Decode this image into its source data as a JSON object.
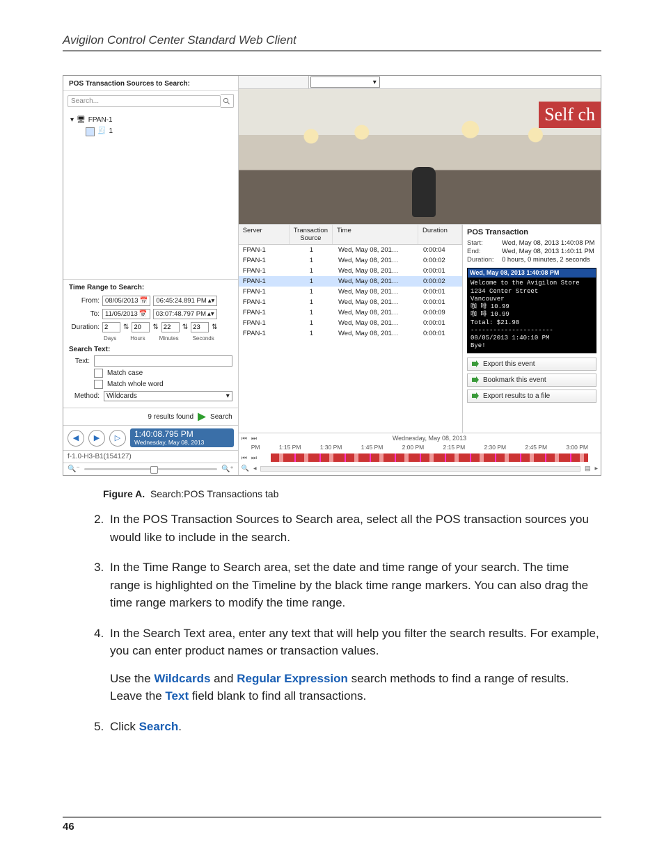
{
  "header": {
    "running": "Avigilon Control Center Standard Web Client"
  },
  "pageNumber": "46",
  "caption": {
    "label": "Figure A.",
    "text": "Search:POS Transactions tab"
  },
  "instructions": [
    {
      "n": "2.",
      "text": "In the POS Transaction Sources to Search area, select all the POS transaction sources you would like to include in the search."
    },
    {
      "n": "3.",
      "text": "In the Time Range to Search area, set the date and time range of your search. The time range is highlighted on the Timeline by the black time range markers. You can also drag the time range markers to modify the time range."
    },
    {
      "n": "4.",
      "text": "In the Search Text area, enter any text that will help you filter the search results. For example, you can enter product names or transaction values.",
      "extra_pre": "Use the ",
      "kw1": "Wildcards",
      "mid1": " and ",
      "kw2": "Regular Expression",
      "mid2": " search methods to find a range of results. Leave the ",
      "kw3": "Text",
      "post": " field blank to find all transactions."
    },
    {
      "n": "5.",
      "pre": "Click ",
      "kw": "Search",
      "post": "."
    }
  ],
  "left": {
    "title": "POS Transaction Sources to Search:",
    "searchPlaceholder": "Search...",
    "tree": {
      "root": "FPAN-1",
      "child": "1"
    },
    "timeTitle": "Time Range to Search:",
    "from": {
      "label": "From:",
      "date": "08/05/2013",
      "time": "06:45:24.891 PM"
    },
    "to": {
      "label": "To:",
      "date": "11/05/2013",
      "time": "03:07:48.797 PM"
    },
    "duration": {
      "label": "Duration:",
      "days": "2",
      "hours": "20",
      "minutes": "22",
      "seconds": "23",
      "lblDays": "Days",
      "lblHours": "Hours",
      "lblMin": "Minutes",
      "lblSec": "Seconds"
    },
    "searchTextLabel": "Search Text:",
    "textLabel": "Text:",
    "matchCase": "Match case",
    "matchWhole": "Match whole word",
    "methodLabel": "Method:",
    "methodValue": "Wildcards",
    "resultsText": "9 results found",
    "searchBtn": "Search",
    "timestamp": {
      "big": "1:40:08.795 PM",
      "small": "Wednesday, May 08, 2013"
    },
    "deviceId": "f-1.0-H3-B1(154127)"
  },
  "video": {
    "sign": "Self ch"
  },
  "table": {
    "headers": [
      "Server",
      "Transaction Source",
      "Time",
      "Duration"
    ],
    "rows": [
      [
        "FPAN-1",
        "1",
        "Wed, May 08, 201…",
        "0:00:04"
      ],
      [
        "FPAN-1",
        "1",
        "Wed, May 08, 201…",
        "0:00:02"
      ],
      [
        "FPAN-1",
        "1",
        "Wed, May 08, 201…",
        "0:00:01"
      ],
      [
        "FPAN-1",
        "1",
        "Wed, May 08, 201…",
        "0:00:02",
        "selected"
      ],
      [
        "FPAN-1",
        "1",
        "Wed, May 08, 201…",
        "0:00:01"
      ],
      [
        "FPAN-1",
        "1",
        "Wed, May 08, 201…",
        "0:00:01"
      ],
      [
        "FPAN-1",
        "1",
        "Wed, May 08, 201…",
        "0:00:09"
      ],
      [
        "FPAN-1",
        "1",
        "Wed, May 08, 201…",
        "0:00:01"
      ],
      [
        "FPAN-1",
        "1",
        "Wed, May 08, 201…",
        "0:00:01"
      ]
    ]
  },
  "details": {
    "title": "POS Transaction",
    "start": {
      "k": "Start:",
      "v": "Wed, May 08, 2013 1:40:08 PM"
    },
    "end": {
      "k": "End:",
      "v": "Wed, May 08, 2013 1:40:11 PM"
    },
    "dur": {
      "k": "Duration:",
      "v": "0 hours, 0 minutes, 2 seconds"
    },
    "receiptHeader": "Wed, May 08, 2013 1:40:08 PM",
    "receiptLines": [
      "Welcome to the Avigilon Store",
      "      1234 Center Street",
      "          Vancouver",
      "咖 啡            10.99",
      "咖 啡            10.99",
      "Total:          $21.98",
      "----------------------",
      "08/05/2013 1:40:10 PM",
      " Bye!"
    ],
    "actions": [
      "Export this event",
      "Bookmark this event",
      "Export results to a file"
    ]
  },
  "timeline": {
    "date": "Wednesday, May 08, 2013",
    "ticks": [
      "PM",
      "1:15 PM",
      "1:30 PM",
      "1:45 PM",
      "2:00 PM",
      "2:15 PM",
      "2:30 PM",
      "2:45 PM",
      "3:00 PM"
    ]
  }
}
